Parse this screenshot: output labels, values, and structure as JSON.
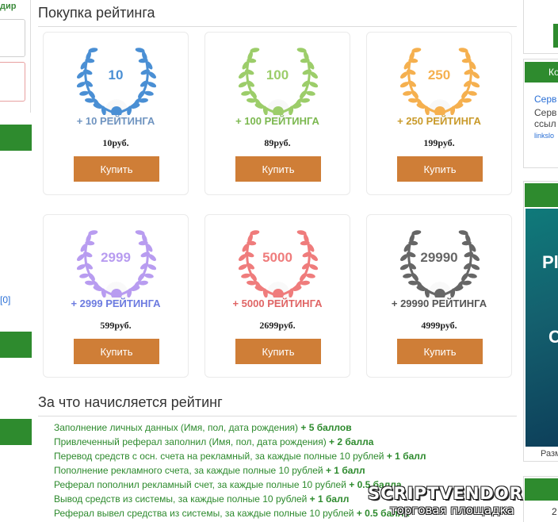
{
  "left_sidebar": {
    "top_text": "дир",
    "link_text": "[0]"
  },
  "right_sidebar": {
    "header1": "Ко",
    "line1": "Серв",
    "line2a": "Серв",
    "line2b": "ссыл",
    "line3": "linkslo",
    "banner_r": "Pl",
    "banner_c": "C",
    "footer_text": "Разм",
    "bottom_num": "2"
  },
  "purchase": {
    "title": "Покупка рейтинга",
    "buy_label": "Купить",
    "cards": [
      {
        "number": "10",
        "rating": "+ 10 РЕЙТИНГА",
        "price": "10руб.",
        "color": "#4a8fd4",
        "rating_color": "#6f94c0"
      },
      {
        "number": "100",
        "rating": "+ 100 РЕЙТИНГА",
        "price": "89руб.",
        "color": "#9ccd6a",
        "rating_color": "#7cb850"
      },
      {
        "number": "250",
        "rating": "+ 250 РЕЙТИНГА",
        "price": "199руб.",
        "color": "#f5b04f",
        "rating_color": "#c99a2a"
      },
      {
        "number": "2999",
        "rating": "+ 2999 РЕЙТИНГА",
        "price": "599руб.",
        "color": "#b89cf0",
        "rating_color": "#6c7be0"
      },
      {
        "number": "5000",
        "rating": "+ 5000 РЕЙТИНГА",
        "price": "2699руб.",
        "color": "#ef7c7c",
        "rating_color": "#e06565"
      },
      {
        "number": "29990",
        "rating": "+ 29990 РЕЙТИНГА",
        "price": "4999руб.",
        "color": "#666666",
        "rating_color": "#555555"
      }
    ]
  },
  "earn": {
    "title": "За что начисляется рейтинг",
    "items": [
      {
        "text": "Заполнение личных данных (Имя, пол, дата рождения) ",
        "bonus": "+ 5 баллов"
      },
      {
        "text": "Привлеченный реферал заполнил (Имя, пол, дата рождения) ",
        "bonus": "+ 2 балла"
      },
      {
        "text": "Перевод средств с осн. счета на рекламный, за каждые полные 10 рублей ",
        "bonus": "+ 1 балл"
      },
      {
        "text": "Пополнение рекламного счета, за каждые полные 10 рублей ",
        "bonus": "+ 1 балл"
      },
      {
        "text": "Реферал пополнил рекламный счет, за каждые полные 10 рублей ",
        "bonus": "+ 0.5 балла"
      },
      {
        "text": "Вывод средств из системы, за каждые полные 10 рублей ",
        "bonus": "+ 1 балл"
      },
      {
        "text": "Реферал вывел средства из системы, за каждые полные 10 рублей ",
        "bonus": "+ 0.5 балла"
      }
    ]
  },
  "watermark": {
    "line1": "SCRIPTVENDOR",
    "line2": "торговая площадка"
  }
}
